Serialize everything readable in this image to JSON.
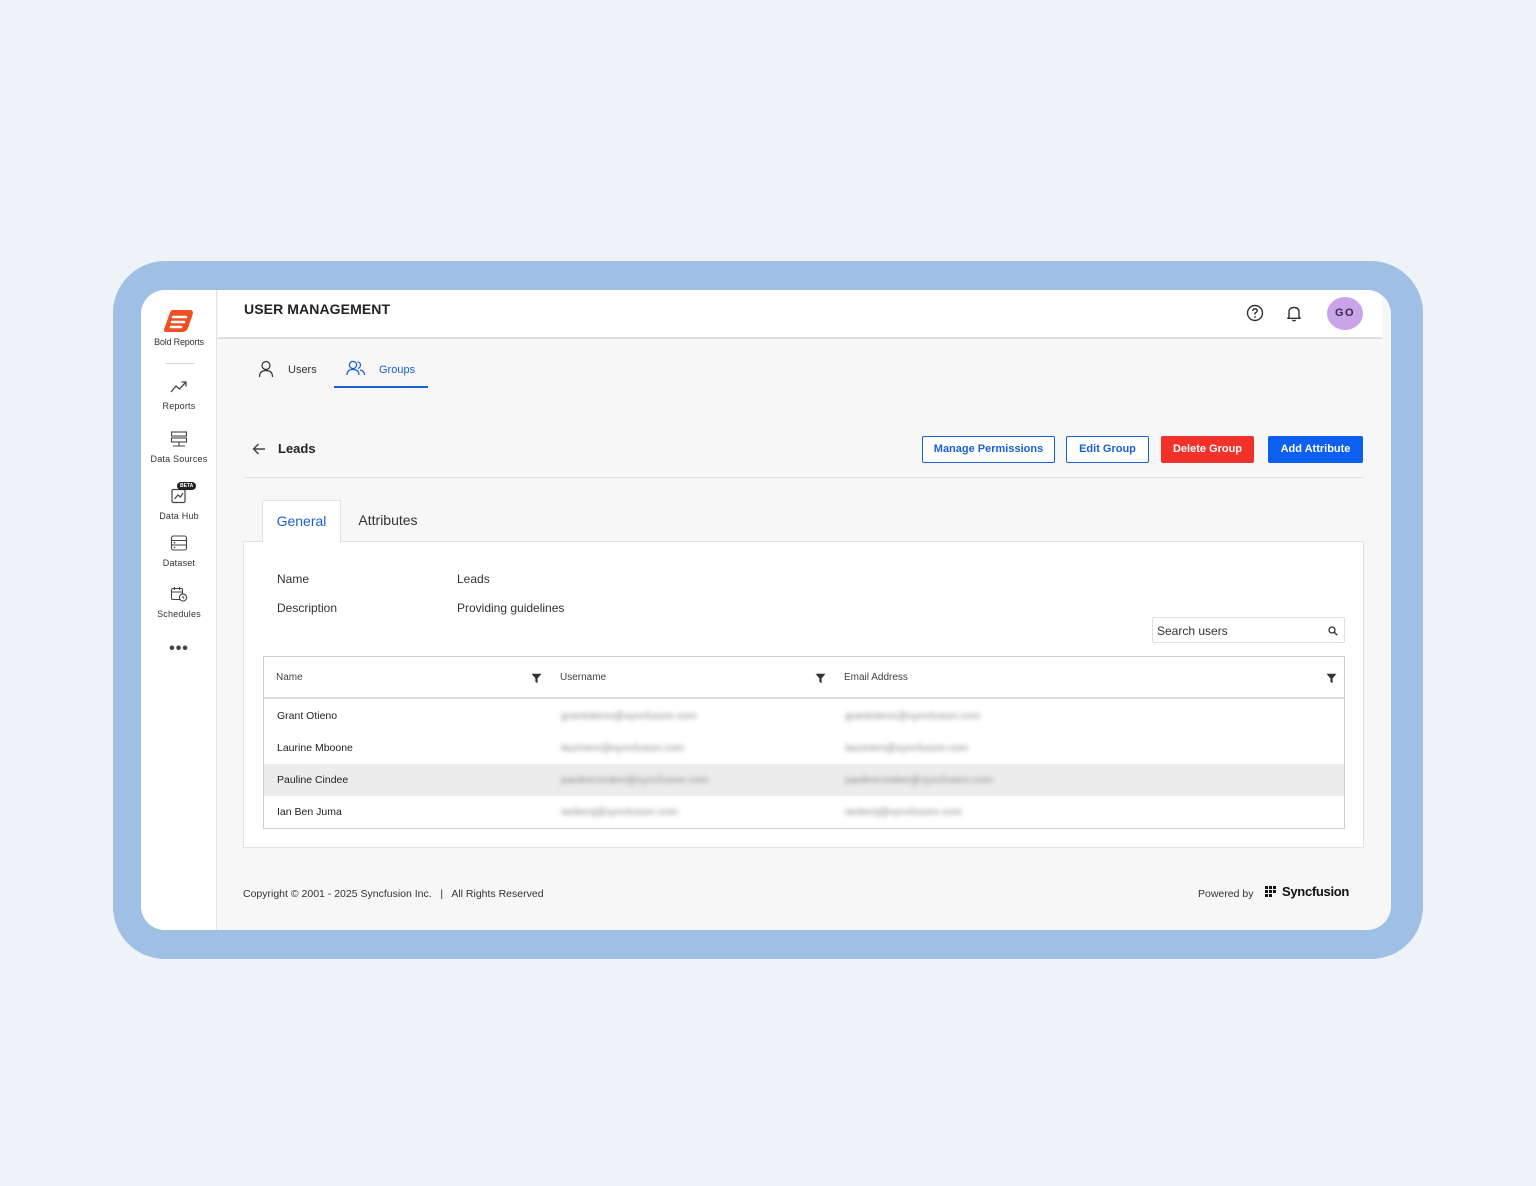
{
  "app": {
    "logo_text": "Bold Reports",
    "page_title": "USER MANAGEMENT",
    "avatar_initials": "GO",
    "brand_color": "#1a5fd8"
  },
  "sidebar": {
    "items": [
      {
        "label": "Reports",
        "icon": "trend-icon"
      },
      {
        "label": "Data Sources",
        "icon": "server-icon"
      },
      {
        "label": "Data Hub",
        "icon": "data-hub-icon",
        "badge": "BETA"
      },
      {
        "label": "Dataset",
        "icon": "dataset-icon"
      },
      {
        "label": "Schedules",
        "icon": "calendar-clock-icon"
      }
    ],
    "more": "•••"
  },
  "tabs": {
    "users": "Users",
    "groups": "Groups",
    "active": "Groups"
  },
  "group": {
    "name": "Leads",
    "buttons": {
      "manage_permissions": "Manage Permissions",
      "edit_group": "Edit Group",
      "delete_group": "Delete Group",
      "add_attribute": "Add Attribute"
    }
  },
  "content_tabs": {
    "general": "General",
    "attributes": "Attributes",
    "active": "General"
  },
  "details": {
    "name_label": "Name",
    "name_value": "Leads",
    "description_label": "Description",
    "description_value": "Providing guidelines"
  },
  "search": {
    "placeholder": "Search users"
  },
  "table": {
    "columns": [
      "Name",
      "Username",
      "Email Address"
    ],
    "rows": [
      {
        "name": "Grant Otieno",
        "username": "grantotieno@syncfusion.com",
        "email": "grantotieno@syncfusion.com"
      },
      {
        "name": "Laurine Mboone",
        "username": "laurinem@syncfusion.com",
        "email": "laurinem@syncfusion.com"
      },
      {
        "name": "Pauline Cindee",
        "username": "paulinecindee@syncfusion.com",
        "email": "paulinecindee@syncfusion.com"
      },
      {
        "name": "Ian Ben Juma",
        "username": "ianbenj@syncfusion.com",
        "email": "ianbenj@syncfusion.com"
      }
    ],
    "highlighted_row": 2
  },
  "footer": {
    "copyright": "Copyright © 2001 - 2025 Syncfusion Inc.   |   All Rights Reserved",
    "powered_by": "Powered by",
    "brand": "Syncfusion"
  }
}
